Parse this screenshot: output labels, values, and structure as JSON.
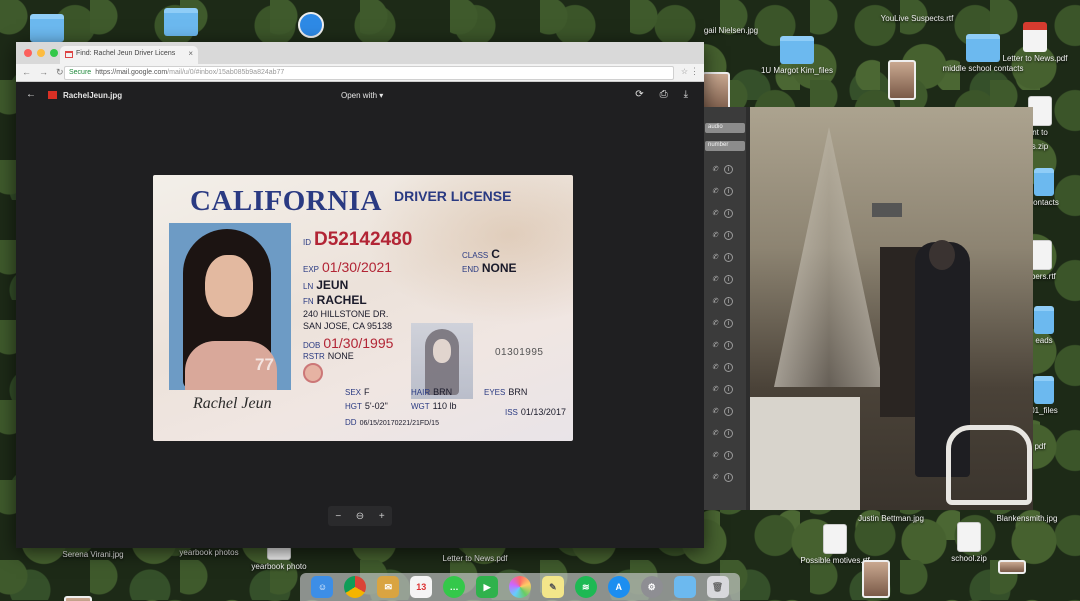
{
  "browser": {
    "tab_title": "Find: Rachel Jeun Driver Licens",
    "url_secure_label": "Secure",
    "url_host": "https://mail.google.com",
    "url_path": "/mail/u/0/#inbox/15ab085b9a824ab77",
    "file_name": "RachelJeun.jpg",
    "open_with_label": "Open with",
    "zoom_out": "−",
    "zoom_reset": "⊖",
    "zoom_in": "+"
  },
  "license": {
    "state": "CALIFORNIA",
    "type": "DRIVER LICENSE",
    "id_label": "ID",
    "id_number": "D52142480",
    "exp_label": "EXP",
    "exp_date": "01/30/2021",
    "ln_label": "LN",
    "last_name": "JEUN",
    "fn_label": "FN",
    "first_name": "RACHEL",
    "address_line1": "240 HILLSTONE DR.",
    "address_line2": "SAN JOSE, CA 95138",
    "dob_label": "DOB",
    "dob": "01/30/1995",
    "rstr_label": "RSTR",
    "rstr": "NONE",
    "class_label": "CLASS",
    "class": "C",
    "end_label": "END",
    "end": "NONE",
    "sex_label": "SEX",
    "sex": "F",
    "hgt_label": "HGT",
    "hgt": "5'-02\"",
    "hair_label": "HAIR",
    "hair": "BRN",
    "wgt_label": "WGT",
    "wgt": "110 lb",
    "eyes_label": "EYES",
    "eyes": "BRN",
    "iss_label": "ISS",
    "iss": "01/13/2017",
    "dd_label": "DD",
    "dd": "06/15/20170221/21FD/15",
    "card_number": "01301995",
    "photo_watermark": "77",
    "signature": "Rachel Jeun"
  },
  "video": {
    "contacts_tag_1": "audio",
    "contacts_tag_2": "number"
  },
  "desktop": {
    "icons": [
      "gail Nielsen.jpg",
      "1U Margot Kim_files",
      "YouLive Suspects.rtf",
      "middle school contacts",
      "Letter to News.pdf",
      "Serena Virani.jpg",
      "yearbook photos",
      "yearbook photo",
      "Letter to News.pdf",
      "Possible motives.rtf",
      "Justin Bettman.jpg",
      "school.zip",
      "Blankensmith.jpg"
    ],
    "edge_labels": [
      "nt to",
      "s.zip",
      "contacts",
      "mbers.rtf",
      "eads",
      "01_files",
      "pdf"
    ]
  },
  "dock": {
    "items": [
      "finder",
      "chrome",
      "mail",
      "calendar",
      "messages",
      "facetime",
      "photos",
      "notes",
      "spotify",
      "app-store",
      "settings",
      "folder",
      "trash"
    ],
    "calendar_day": "13"
  },
  "colors": {
    "license_blue": "#2a3a82",
    "license_red": "#b22535",
    "folder_blue": "#6cb9ef"
  }
}
